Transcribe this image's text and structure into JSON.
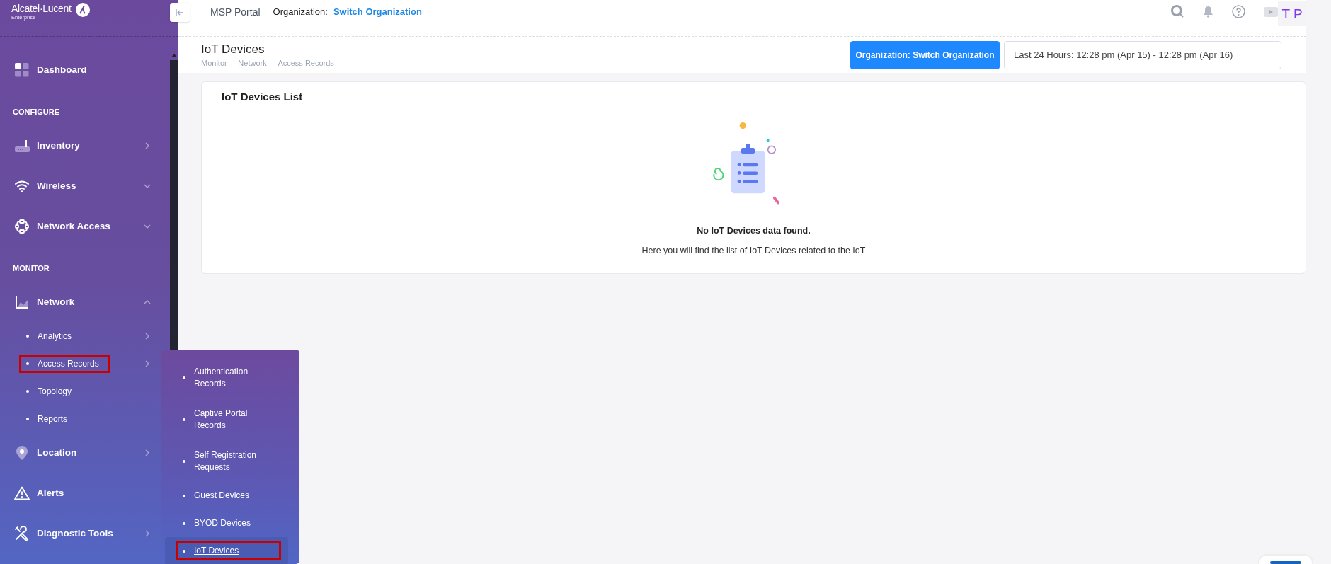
{
  "sidebar": {
    "logo": "Alcatel·Lucent",
    "logo_sub": "Enterprise",
    "items": [
      {
        "kind": "item",
        "label": "Dashboard"
      },
      {
        "kind": "section",
        "label": "CONFIGURE"
      },
      {
        "kind": "item",
        "label": "Inventory",
        "flyout": true
      },
      {
        "kind": "item",
        "label": "Wireless",
        "expanded": false
      },
      {
        "kind": "item",
        "label": "Network Access",
        "expanded": false
      },
      {
        "kind": "section",
        "label": "MONITOR"
      },
      {
        "kind": "item",
        "label": "Network",
        "expanded": true,
        "children": [
          {
            "label": "Analytics",
            "flyout": true,
            "highlighted": false
          },
          {
            "label": "Access Records",
            "flyout": true,
            "highlighted": true,
            "children": [
              {
                "label": "Authentication Records",
                "selected": false,
                "highlighted": false
              },
              {
                "label": "Captive Portal Records",
                "selected": false,
                "highlighted": false
              },
              {
                "label": "Self Registration Requests",
                "selected": false,
                "highlighted": false
              },
              {
                "label": "Guest Devices",
                "selected": false,
                "highlighted": false
              },
              {
                "label": "BYOD Devices",
                "selected": false,
                "highlighted": false
              },
              {
                "label": "IoT Devices",
                "selected": true,
                "highlighted": true
              }
            ]
          },
          {
            "label": "Topology",
            "flyout": false,
            "highlighted": false
          },
          {
            "label": "Reports",
            "flyout": false,
            "highlighted": false
          }
        ]
      },
      {
        "kind": "item",
        "label": "Location",
        "flyout": true
      },
      {
        "kind": "item",
        "label": "Alerts"
      },
      {
        "kind": "item",
        "label": "Diagnostic Tools",
        "flyout": true
      }
    ]
  },
  "topbar": {
    "portal": "MSP Portal",
    "org_label": "Organization:",
    "org_link": "Switch Organization",
    "avatar": "T P"
  },
  "page": {
    "title": "IoT Devices",
    "breadcrumb": [
      "Monitor",
      "-",
      "Network",
      "-",
      "Access Records"
    ],
    "org_button": "Organization: Switch Organization",
    "time_range": "Last 24 Hours: 12:28 pm (Apr 15) - 12:28 pm (Apr 16)"
  },
  "card": {
    "title": "IoT Devices List",
    "empty_title": "No IoT Devices data found.",
    "empty_text": "Here you will find the list of IoT Devices related to the IoT"
  }
}
